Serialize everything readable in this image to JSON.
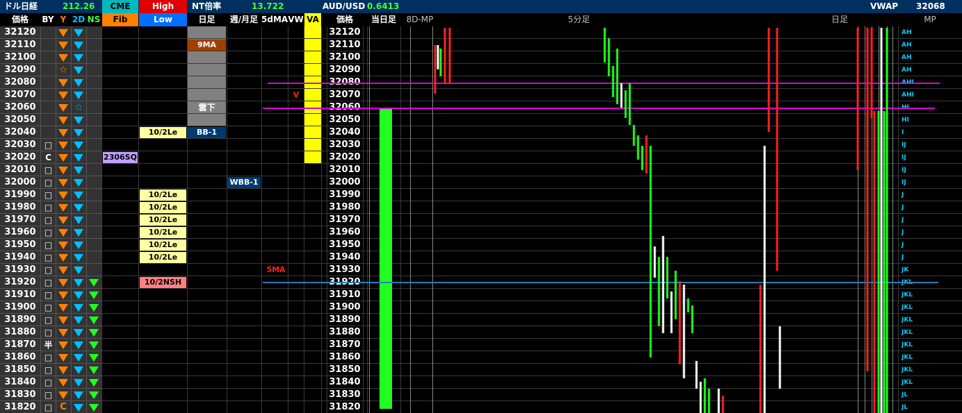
{
  "header": {
    "dollar_nikkei_label": "ドル日経",
    "dollar_nikkei_value": "212.26",
    "cme_label": "CME",
    "high_label": "High",
    "nt_label": "NT倍率",
    "nt_value": "13.722",
    "audusd_label": "AUD/USD",
    "audusd_value": "0.6413",
    "vwap_label": "VWAP",
    "vwap_value": "32068"
  },
  "columns": {
    "price": "価格",
    "by": "BY",
    "y": "Y",
    "d2": "2D",
    "ns": "NS",
    "fib": "Fib",
    "low": "Low",
    "daily": "日足",
    "weekly_monthly": "週/月足",
    "ma5d": "5dMA",
    "vw": "VW",
    "va": "VA",
    "price2": "価格",
    "today_daily": "当日足",
    "mp8d": "8D-MP",
    "min5": "5分足",
    "daily2": "日足",
    "mp": "MP"
  },
  "prices": [
    "32120",
    "32110",
    "32100",
    "32090",
    "32080",
    "32070",
    "32060",
    "32050",
    "32040",
    "32030",
    "32020",
    "32010",
    "32000",
    "31990",
    "31980",
    "31970",
    "31960",
    "31950",
    "31940",
    "31930",
    "31920",
    "31910",
    "31900",
    "31890",
    "31880",
    "31870",
    "31860",
    "31850",
    "31840",
    "31830",
    "31820"
  ],
  "by_marks": [
    "",
    "",
    "",
    "",
    "",
    "",
    "",
    "",
    "",
    "□",
    "C",
    "□",
    "□",
    "□",
    "□",
    "□",
    "□",
    "□",
    "□",
    "□",
    "□",
    "□",
    "□",
    "□",
    "□",
    "半",
    "□",
    "□",
    "□",
    "□",
    "□"
  ],
  "y_marks": [
    "tri",
    "tri",
    "tri",
    "star",
    "tri",
    "tri",
    "tri",
    "tri",
    "tri",
    "tri",
    "tri",
    "tri",
    "tri",
    "tri",
    "tri",
    "tri",
    "tri",
    "tri",
    "tri",
    "tri",
    "tri",
    "tri",
    "tri",
    "tri",
    "tri",
    "tri",
    "tri",
    "tri",
    "tri",
    "tri",
    "C"
  ],
  "d2_marks": [
    "tri",
    "tri",
    "tri",
    "tri",
    "tri",
    "tri",
    "star",
    "tri",
    "tri",
    "tri",
    "tri",
    "tri",
    "tri",
    "tri",
    "tri",
    "tri",
    "tri",
    "tri",
    "tri",
    "tri",
    "tri",
    "tri",
    "tri",
    "tri",
    "tri",
    "tri",
    "tri",
    "tri",
    "tri",
    "tri",
    "tri"
  ],
  "ns_marks": [
    "",
    "",
    "",
    "",
    "",
    "",
    "",
    "",
    "",
    "",
    "",
    "",
    "",
    "",
    "",
    "",
    "",
    "",
    "",
    "",
    "g",
    "g",
    "g",
    "g",
    "g",
    "g",
    "g",
    "g",
    "g",
    "g",
    "g"
  ],
  "mp_letters": [
    "AH",
    "AH",
    "AH",
    "AH",
    "AHI",
    "AHI",
    "HI",
    "HI",
    "I",
    "IJ",
    "IJ",
    "IJ",
    "IJ",
    "J",
    "J",
    "J",
    "J",
    "J",
    "J",
    "JK",
    "JKL",
    "JKL",
    "JKL",
    "JKL",
    "JKL",
    "JKL",
    "JKL",
    "JKL",
    "JKL",
    "JL",
    "JL"
  ],
  "tags": {
    "cme_2306sq": "2306SQ",
    "le_1": "10/2Le",
    "le_list": [
      "10/2Le",
      "10/2Le",
      "10/2Le",
      "10/2Le",
      "10/2Le",
      "10/2Le"
    ],
    "nsh": "10/2NSH",
    "ma9": "9MA",
    "kumo_shita": "雲下",
    "bb1": "BB-1",
    "wbb1": "WBB-1",
    "ma5": "5MA",
    "v_mark": "V"
  },
  "colors": {
    "header_bg": "#003060",
    "cme_bg": "#00b8c0",
    "high_bg": "#e00000",
    "fib_bg": "#ff8000",
    "low_bg": "#0070ff",
    "va_yellow": "#ffff00",
    "bar_green": "#20ff20",
    "line_magenta": "#e000e0",
    "line_blue": "#2080c0"
  }
}
